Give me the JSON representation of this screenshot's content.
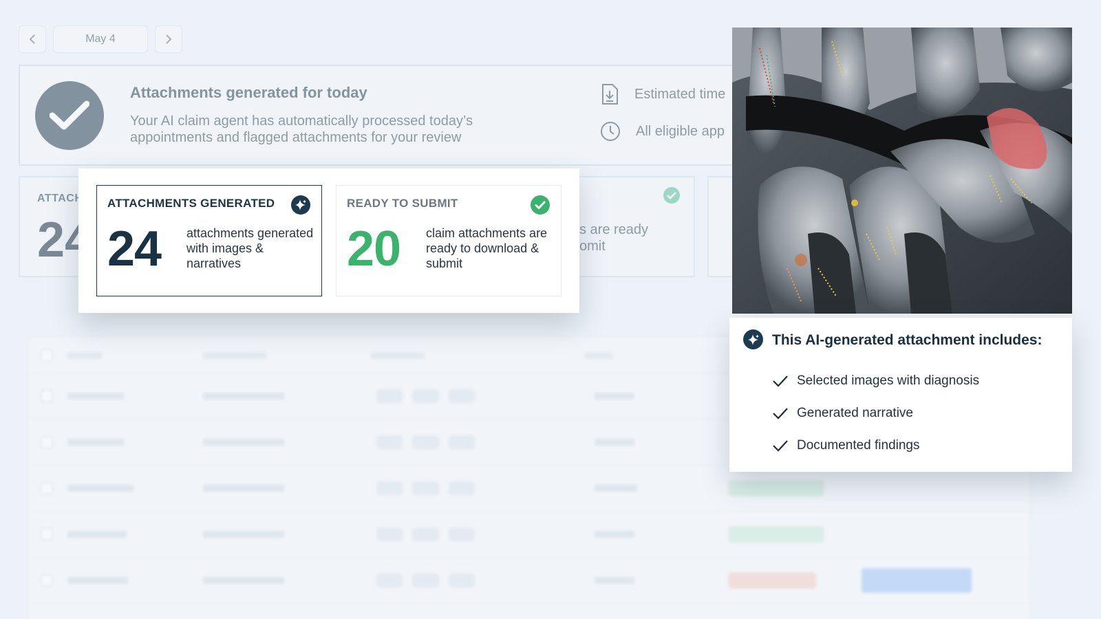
{
  "date_nav": {
    "prev_icon": "chevron-left-icon",
    "next_icon": "chevron-right-icon",
    "current_date": "May 4"
  },
  "banner": {
    "title": "Attachments generated for today",
    "description": "Your AI claim agent has automatically processed today’s appointments and flagged attachments for your review",
    "side_items": [
      {
        "icon": "download-icon",
        "text": "Estimated time"
      },
      {
        "icon": "clock-icon",
        "text": "All eligible app"
      }
    ]
  },
  "bg_stats": {
    "first_label": "ATTACH",
    "first_value": "24",
    "second_text_line1": "s are ready",
    "second_text_line2": "omit"
  },
  "popup": {
    "generated": {
      "label": "ATTACHMENTS GENERATED",
      "value": "24",
      "text": "attachments generated with images & narratives",
      "icon": "ai-sparkle-icon"
    },
    "ready": {
      "label": "READY TO SUBMIT",
      "value": "20",
      "text": "claim attachments are ready to download & submit",
      "icon": "check-circle-icon"
    }
  },
  "ai_card": {
    "icon": "ai-sparkle-icon",
    "title": "This AI-generated attachment includes:",
    "items": [
      "Selected images with diagnosis",
      "Generated narrative",
      "Documented findings"
    ]
  },
  "colors": {
    "brand_dark": "#1d3b4f",
    "success_green": "#3bb36d",
    "page_bg": "#edf2f8"
  }
}
